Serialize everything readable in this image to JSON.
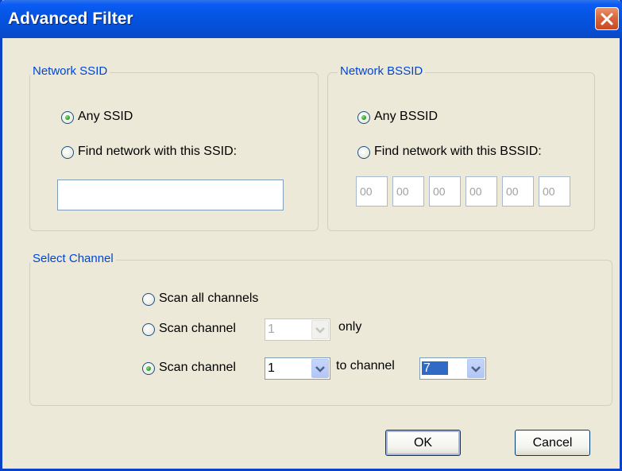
{
  "window": {
    "title": "Advanced Filter"
  },
  "ssid_group": {
    "legend": "Network SSID",
    "any_label": "Any SSID",
    "find_label": "Find network with this SSID:",
    "ssid_value": ""
  },
  "bssid_group": {
    "legend": "Network BSSID",
    "any_label": "Any BSSID",
    "find_label": "Find network with this BSSID:",
    "octets": [
      "00",
      "00",
      "00",
      "00",
      "00",
      "00"
    ]
  },
  "channel_group": {
    "legend": "Select Channel",
    "all_label": "Scan all channels",
    "single_label": "Scan channel",
    "single_value": "1",
    "only_label": "only",
    "range_label": "Scan channel",
    "range_from": "1",
    "to_label": "to channel",
    "range_to": "7"
  },
  "buttons": {
    "ok": "OK",
    "cancel": "Cancel"
  },
  "icons": {
    "close": "close-icon",
    "dropdown": "chevron-down-icon"
  }
}
